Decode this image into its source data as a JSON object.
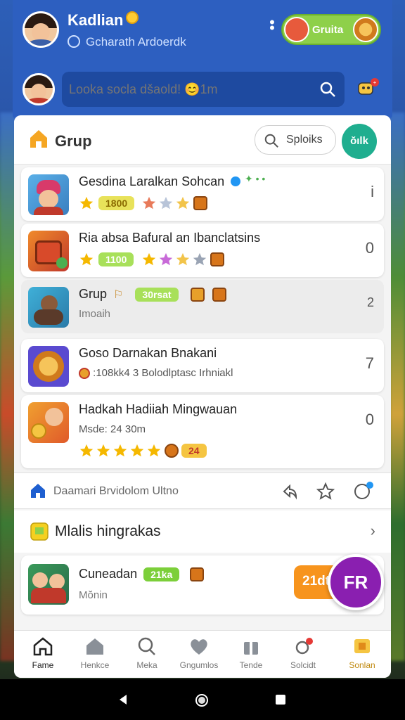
{
  "header": {
    "user_name": "Kadlian",
    "user_subtitle": "Gcharath Ardoerdk",
    "group_pill_label": "Gruita",
    "search_placeholder": "Looka socla dšaold! 😊1m"
  },
  "panel": {
    "title": "Grup",
    "search_button_label": "Sploiks",
    "action_button_label": "ŏılk",
    "rows": [
      {
        "title": "Gesdina Laralkan Sohcan",
        "meta_pill": "1800",
        "count": "i"
      },
      {
        "title": "Ria absa Bafural an Ibanclatsins",
        "meta_pill": "1100",
        "count": "0"
      },
      {
        "title": "Grup",
        "meta_pill": "30rsat",
        "sub": "Imoaih",
        "count": "2"
      },
      {
        "title": "Goso Darnakan Bnakani",
        "meta_text": ":108kk4 3 Bolodlptasc Irhniakl",
        "count": "7"
      },
      {
        "title": "Hadkah Hadiiah Mingwauan",
        "sub": "Msde: 24 30m",
        "badge": "24",
        "count": "0"
      }
    ],
    "nav_row_label": "Daamari Brvidolom Ultno",
    "section_label": "Mlalis hingrakas",
    "promo": {
      "title": "Cuneadan",
      "pill": "21ka",
      "sub": "Mŏnin",
      "button": "21dt",
      "fab": "FR"
    },
    "tabs": [
      {
        "label": "Fame",
        "icon": "home-icon"
      },
      {
        "label": "Henkce",
        "icon": "house-icon"
      },
      {
        "label": "Meka",
        "icon": "search-icon"
      },
      {
        "label": "Gngumlos",
        "icon": "heart-icon"
      },
      {
        "label": "Tende",
        "icon": "gift-icon"
      },
      {
        "label": "Solcidt",
        "icon": "settings-icon"
      },
      {
        "label": "Sonlan",
        "icon": "trophy-icon"
      }
    ]
  },
  "colors": {
    "header_blue": "#2d5fc0",
    "accent_green": "#8ed04a",
    "teal": "#1fae8f",
    "orange": "#f7941d",
    "purple": "#8a1fb0"
  }
}
